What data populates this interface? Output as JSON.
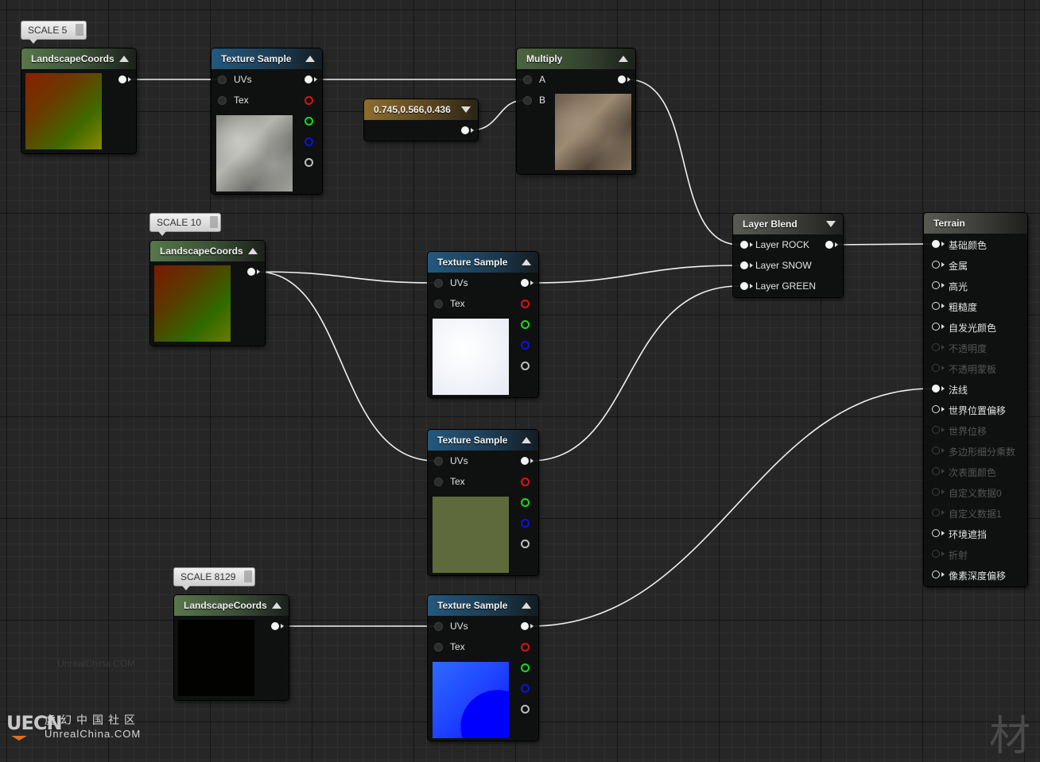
{
  "comments": {
    "scale5": "SCALE 5",
    "scale10": "SCALE 10",
    "scale8129": "SCALE 8129"
  },
  "nodes": {
    "lc1": {
      "title": "LandscapeCoords"
    },
    "lc2": {
      "title": "LandscapeCoords"
    },
    "lc3": {
      "title": "LandscapeCoords"
    },
    "ts1": {
      "title": "Texture Sample",
      "uvs": "UVs",
      "tex": "Tex"
    },
    "ts2": {
      "title": "Texture Sample",
      "uvs": "UVs",
      "tex": "Tex"
    },
    "ts3": {
      "title": "Texture Sample",
      "uvs": "UVs",
      "tex": "Tex"
    },
    "ts4": {
      "title": "Texture Sample",
      "uvs": "UVs",
      "tex": "Tex"
    },
    "multiply": {
      "title": "Multiply",
      "a": "A",
      "b": "B"
    },
    "constant": {
      "title": "0.745,0.566,0.436"
    },
    "layerblend": {
      "title": "Layer Blend",
      "layers": [
        "Layer ROCK",
        "Layer SNOW",
        "Layer GREEN"
      ]
    },
    "terrain": {
      "title": "Terrain",
      "inputs": [
        {
          "label": "基础颜色",
          "state": "connected"
        },
        {
          "label": "金属",
          "state": "active"
        },
        {
          "label": "高光",
          "state": "active"
        },
        {
          "label": "粗糙度",
          "state": "active"
        },
        {
          "label": "自发光颜色",
          "state": "active"
        },
        {
          "label": "不透明度",
          "state": "disabled"
        },
        {
          "label": "不透明蒙板",
          "state": "disabled"
        },
        {
          "label": "法线",
          "state": "connected"
        },
        {
          "label": "世界位置偏移",
          "state": "active"
        },
        {
          "label": "世界位移",
          "state": "disabled"
        },
        {
          "label": "多边形细分乘数",
          "state": "disabled"
        },
        {
          "label": "次表面颜色",
          "state": "disabled"
        },
        {
          "label": "自定义数据0",
          "state": "disabled"
        },
        {
          "label": "自定义数据1",
          "state": "disabled"
        },
        {
          "label": "环境遮挡",
          "state": "active"
        },
        {
          "label": "折射",
          "state": "disabled"
        },
        {
          "label": "像素深度偏移",
          "state": "active"
        }
      ]
    }
  },
  "pin_colors": [
    "#ffffff",
    "#e01010",
    "#10e010",
    "#1010e0",
    "#bdbdbd"
  ],
  "watermark": {
    "center": "UnrealChina.COM",
    "logo": "UECN",
    "cn": "虚幻中国社区",
    "en": "UnrealChina.COM",
    "corner": "材"
  }
}
